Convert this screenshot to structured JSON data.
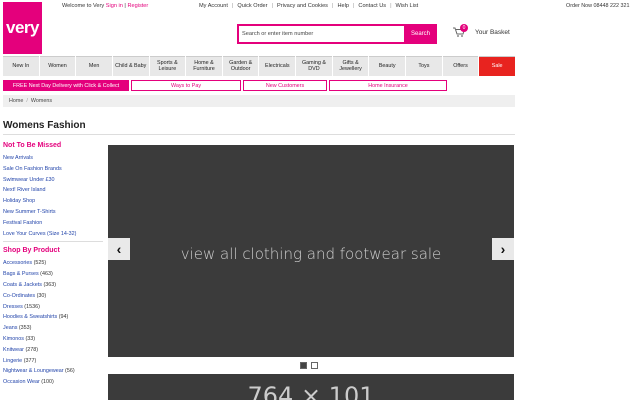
{
  "brand": {
    "logo_text": "very",
    "accent": "#e4007c",
    "sale_color": "#e8231f"
  },
  "header": {
    "welcome": "Welcome to Very",
    "sign_in": "Sign in",
    "sep": "|",
    "register": "Register",
    "links": [
      "My Account",
      "Quick Order",
      "Privacy and Cookies",
      "Help",
      "Contact Us",
      "Wish List"
    ],
    "order_now": "Order Now 08448 222 321"
  },
  "search": {
    "placeholder": "Search or enter item number",
    "button": "Search"
  },
  "basket": {
    "count": "0",
    "label": "Your Basket",
    "icon": "cart-icon"
  },
  "nav": [
    "New In",
    "Women",
    "Men",
    "Child & Baby",
    "Sports & Leisure",
    "Home & Furniture",
    "Garden & Outdoor",
    "Electricals",
    "Gaming & DVD",
    "Gifts & Jewellery",
    "Beauty",
    "Toys",
    "Offers",
    "Sale"
  ],
  "promos": [
    "FREE Next Day Delivery with Click & Collect",
    "Ways to Pay",
    "New Customers",
    "Home Insurance"
  ],
  "breadcrumb": {
    "home": "Home",
    "sep": "/",
    "current": "Womens"
  },
  "page_title": "Womens Fashion",
  "sidebar": {
    "section1_title": "Not To Be Missed",
    "section1": [
      "New Arrivals",
      "Sale On Fashion Brands",
      "Swimwear Under £30",
      "Next! River Island",
      "Holiday Shop",
      "New Summer T-Shirts",
      "Festival Fashion",
      "Love Your Curves (Size 14-32)"
    ],
    "section2_title": "Shop By Product",
    "section2": [
      {
        "label": "Accessories",
        "count": "(525)"
      },
      {
        "label": "Bags & Purses",
        "count": "(463)"
      },
      {
        "label": "Coats & Jackets",
        "count": "(363)"
      },
      {
        "label": "Co-Ordinates",
        "count": "(30)"
      },
      {
        "label": "Dresses",
        "count": "(1536)"
      },
      {
        "label": "Hoodies & Sweatshirts",
        "count": "(94)"
      },
      {
        "label": "Jeans",
        "count": "(353)"
      },
      {
        "label": "Kimonos",
        "count": "(33)"
      },
      {
        "label": "Knitwear",
        "count": "(278)"
      },
      {
        "label": "Lingerie",
        "count": "(377)"
      },
      {
        "label": "Nightwear & Loungewear",
        "count": "(56)"
      },
      {
        "label": "Occasion Wear",
        "count": "(100)"
      }
    ]
  },
  "carousel": {
    "message": "view all clothing and footwear sale",
    "prev_icon": "‹",
    "next_icon": "›"
  },
  "banner2": {
    "text": "764 × 101"
  }
}
